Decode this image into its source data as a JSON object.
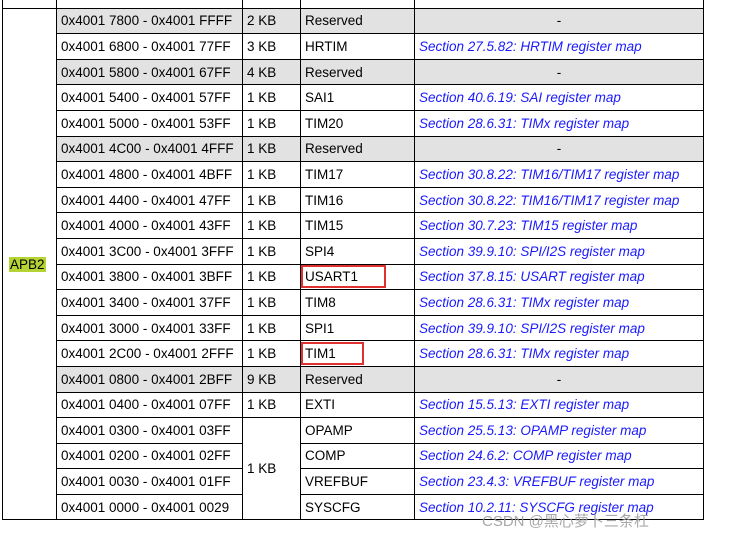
{
  "bus": "APB2",
  "rows": [
    {
      "addr": "",
      "size": "",
      "name": "",
      "link": ""
    },
    {
      "addr": "0x4001 7800 - 0x4001 FFFF",
      "size": "2 KB",
      "name": "Reserved",
      "link": "-",
      "reserved": true
    },
    {
      "addr": "0x4001 6800 - 0x4001 77FF",
      "size": "3 KB",
      "name": "HRTIM",
      "link": "Section 27.5.82: HRTIM register map"
    },
    {
      "addr": "0x4001 5800 - 0x4001 67FF",
      "size": "4 KB",
      "name": "Reserved",
      "link": "-",
      "reserved": true
    },
    {
      "addr": "0x4001 5400 - 0x4001 57FF",
      "size": "1 KB",
      "name": "SAI1",
      "link": "Section 40.6.19: SAI register map"
    },
    {
      "addr": "0x4001 5000 - 0x4001 53FF",
      "size": "1 KB",
      "name": "TIM20",
      "link": "Section 28.6.31: TIMx register map"
    },
    {
      "addr": "0x4001 4C00 - 0x4001 4FFF",
      "size": "1 KB",
      "name": "Reserved",
      "link": "-",
      "reserved": true
    },
    {
      "addr": "0x4001 4800 - 0x4001 4BFF",
      "size": "1 KB",
      "name": "TIM17",
      "link": "Section 30.8.22: TIM16/TIM17 register map"
    },
    {
      "addr": "0x4001 4400 - 0x4001 47FF",
      "size": "1 KB",
      "name": "TIM16",
      "link": "Section 30.8.22: TIM16/TIM17 register map"
    },
    {
      "addr": "0x4001 4000 - 0x4001 43FF",
      "size": "1 KB",
      "name": "TIM15",
      "link": "Section 30.7.23: TIM15 register map"
    },
    {
      "addr": "0x4001 3C00 - 0x4001 3FFF",
      "size": "1 KB",
      "name": "SPI4",
      "link": "Section 39.9.10: SPI/I2S register map"
    },
    {
      "addr": "0x4001 3800 - 0x4001 3BFF",
      "size": "1 KB",
      "name": "USART1",
      "link": "Section 37.8.15: USART register map",
      "boxed": true
    },
    {
      "addr": "0x4001 3400 - 0x4001 37FF",
      "size": "1 KB",
      "name": "TIM8",
      "link": "Section 28.6.31: TIMx register map"
    },
    {
      "addr": "0x4001 3000 - 0x4001 33FF",
      "size": "1 KB",
      "name": "SPI1",
      "link": "Section 39.9.10: SPI/I2S register map"
    },
    {
      "addr": "0x4001 2C00 - 0x4001 2FFF",
      "size": "1 KB",
      "name": "TIM1",
      "link": "Section 28.6.31: TIMx register map",
      "boxed": true
    },
    {
      "addr": "0x4001 0800 - 0x4001 2BFF",
      "size": "9 KB",
      "name": "Reserved",
      "link": "-",
      "reserved": true
    },
    {
      "addr": "0x4001 0400 - 0x4001 07FF",
      "size": "1 KB",
      "name": "EXTI",
      "link": "Section 15.5.13: EXTI register map"
    },
    {
      "addr": "0x4001 0300 - 0x4001 03FF",
      "size": "1 KB",
      "name": "OPAMP",
      "link": "Section 25.5.13: OPAMP register map",
      "span": 4
    },
    {
      "addr": "0x4001 0200 - 0x4001 02FF",
      "name": "COMP",
      "link": "Section 24.6.2: COMP register map",
      "skipSize": true
    },
    {
      "addr": "0x4001 0030 - 0x4001 01FF",
      "name": "VREFBUF",
      "link": "Section 23.4.3: VREFBUF register map",
      "skipSize": true
    },
    {
      "addr": "0x4001 0000 - 0x4001 0029",
      "name": "SYSCFG",
      "link": "Section 10.2.11: SYSCFG register map",
      "skipSize": true
    }
  ],
  "watermark": "CSDN @黑心萝卜三条杠",
  "colors": {
    "link": "#1a1aff",
    "reserved_bg": "#e2e2e2",
    "highlight": "#b5d334",
    "box": "#e03030"
  }
}
